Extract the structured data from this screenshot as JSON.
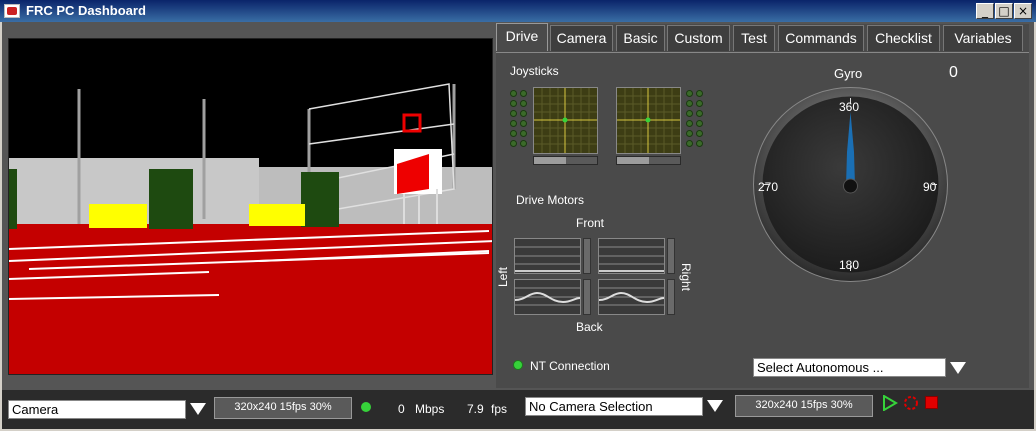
{
  "window": {
    "title": "FRC PC Dashboard",
    "min": "_",
    "max": "□",
    "close": "×"
  },
  "tabs": [
    "Drive",
    "Camera",
    "Basic",
    "Custom",
    "Test",
    "Commands",
    "Checklist",
    "Variables"
  ],
  "drive": {
    "joysticks_label": "Joysticks",
    "joystick_levels": [
      0.5,
      0.5
    ],
    "drive_motors_label": "Drive Motors",
    "front": "Front",
    "back": "Back",
    "left": "Left",
    "right": "Right",
    "nt_connection": "NT Connection"
  },
  "gyro": {
    "label": "Gyro",
    "value": "0",
    "tick_360": "360",
    "tick_90": "90",
    "tick_180": "180",
    "tick_270": "270"
  },
  "autonomous": {
    "selected": "Select Autonomous ..."
  },
  "bottom": {
    "camera_select": "Camera",
    "resolution_left": "320x240   15fps   30%",
    "mbps_value": "0",
    "mbps_unit": "Mbps",
    "fps_value": "7.9",
    "fps_unit": "fps",
    "camera_selection": "No Camera Selection",
    "resolution_right": "320x240   15fps   30%"
  },
  "colors": {
    "accent_green": "#36d23a",
    "record_red": "#e00000",
    "field_red": "#c40000"
  }
}
